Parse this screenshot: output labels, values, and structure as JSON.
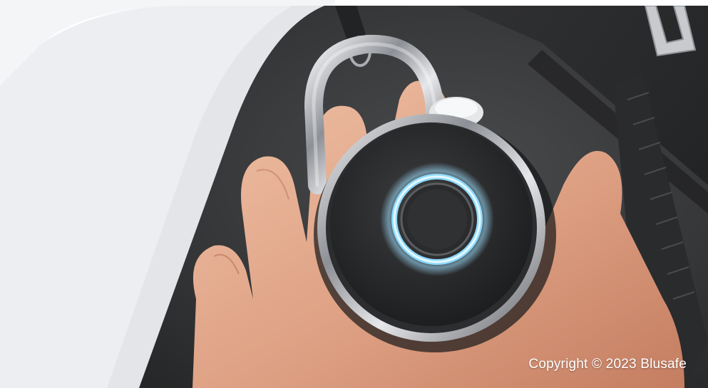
{
  "footer": {
    "copyright_text": "Copyright © 2023 Blusafe"
  },
  "palette": {
    "background_light": "#f1f2f4",
    "background_mid": "#e6e8eb",
    "bag_dark": "#3b3c3d",
    "ring_glow": "#7fd4ff",
    "chrome": "#c9cbcf",
    "skin": "#e2a586"
  },
  "icons": {
    "fingerprint_sensor": "fingerprint-sensor-icon"
  }
}
